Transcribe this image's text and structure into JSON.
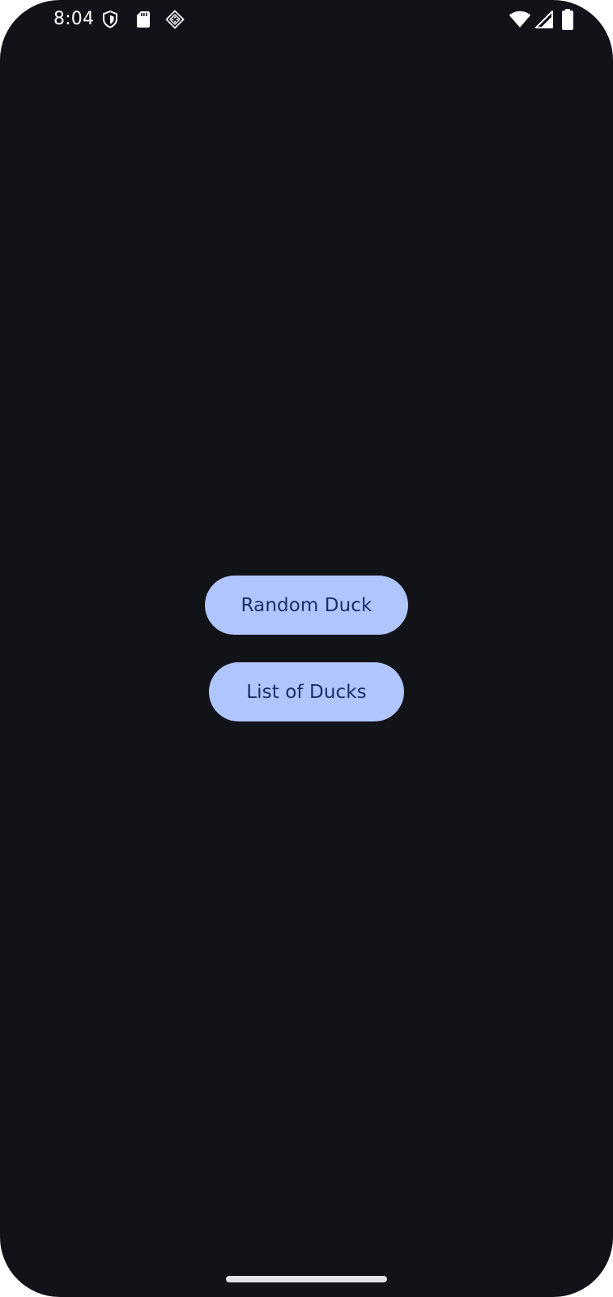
{
  "status_bar": {
    "time": "8:04",
    "left_icons": [
      "shield-icon",
      "sd-card-icon",
      "game-controller-icon"
    ],
    "right_icons": [
      "wifi-icon",
      "cell-signal-icon",
      "battery-icon"
    ]
  },
  "main": {
    "buttons": [
      {
        "label": "Random Duck"
      },
      {
        "label": "List of Ducks"
      }
    ]
  },
  "colors": {
    "background": "#121318",
    "button_fill": "#b1c5ff",
    "button_text": "#1a2f66",
    "status_text": "#ffffff",
    "home_indicator": "#e3e2e8"
  }
}
